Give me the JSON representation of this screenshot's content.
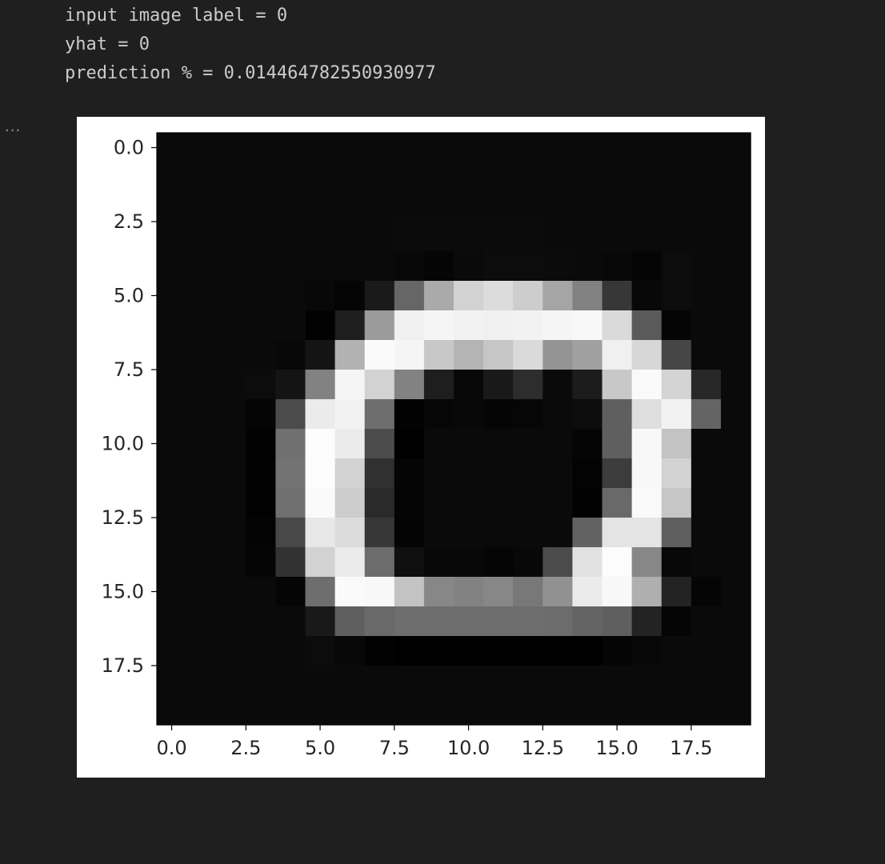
{
  "output": {
    "lines": [
      "input image label = 0",
      "yhat = 0",
      "prediction % = 0.014464782550930977"
    ],
    "overflow_menu": "..."
  },
  "chart_data": {
    "type": "heatmap",
    "colormap": "gray",
    "rows": 20,
    "cols": 20,
    "x_ticks": [
      "0.0",
      "2.5",
      "5.0",
      "7.5",
      "10.0",
      "12.5",
      "15.0",
      "17.5"
    ],
    "y_ticks": [
      "0.0",
      "2.5",
      "5.0",
      "7.5",
      "10.0",
      "12.5",
      "15.0",
      "17.5"
    ],
    "xlim": [
      -0.5,
      19.5
    ],
    "ylim": [
      19.5,
      -0.5
    ],
    "grid": false,
    "values": [
      [
        10,
        10,
        10,
        10,
        10,
        10,
        10,
        10,
        10,
        10,
        10,
        10,
        10,
        10,
        10,
        10,
        10,
        10,
        10,
        10
      ],
      [
        10,
        10,
        10,
        10,
        10,
        10,
        10,
        10,
        10,
        10,
        10,
        10,
        10,
        10,
        10,
        10,
        10,
        10,
        10,
        10
      ],
      [
        10,
        10,
        10,
        10,
        10,
        10,
        10,
        10,
        10,
        10,
        10,
        10,
        10,
        10,
        10,
        10,
        10,
        10,
        10,
        10
      ],
      [
        10,
        10,
        10,
        10,
        10,
        10,
        10,
        10,
        11,
        11,
        11,
        11,
        11,
        10,
        10,
        10,
        10,
        10,
        10,
        10
      ],
      [
        10,
        10,
        10,
        10,
        10,
        10,
        10,
        10,
        8,
        5,
        10,
        12,
        12,
        11,
        10,
        8,
        5,
        12,
        10,
        10
      ],
      [
        10,
        10,
        10,
        10,
        10,
        8,
        5,
        26,
        102,
        170,
        210,
        220,
        205,
        165,
        130,
        55,
        8,
        12,
        10,
        10
      ],
      [
        10,
        10,
        10,
        10,
        10,
        2,
        30,
        155,
        240,
        245,
        242,
        240,
        242,
        245,
        248,
        218,
        90,
        5,
        10,
        10
      ],
      [
        10,
        10,
        10,
        10,
        8,
        20,
        178,
        250,
        245,
        200,
        180,
        198,
        218,
        148,
        160,
        240,
        215,
        70,
        10,
        10
      ],
      [
        10,
        10,
        10,
        12,
        20,
        130,
        245,
        210,
        130,
        30,
        8,
        25,
        45,
        10,
        28,
        200,
        250,
        212,
        40,
        10
      ],
      [
        10,
        10,
        10,
        5,
        75,
        235,
        242,
        110,
        2,
        6,
        8,
        5,
        6,
        10,
        12,
        95,
        222,
        242,
        100,
        10
      ],
      [
        10,
        10,
        10,
        2,
        112,
        252,
        235,
        75,
        0,
        10,
        10,
        10,
        10,
        10,
        5,
        95,
        248,
        195,
        10,
        10
      ],
      [
        10,
        10,
        10,
        2,
        115,
        252,
        210,
        48,
        5,
        10,
        10,
        10,
        10,
        10,
        3,
        60,
        248,
        210,
        10,
        10
      ],
      [
        10,
        10,
        10,
        2,
        112,
        250,
        205,
        42,
        5,
        10,
        10,
        10,
        10,
        10,
        2,
        105,
        250,
        198,
        10,
        10
      ],
      [
        10,
        10,
        10,
        4,
        72,
        232,
        220,
        55,
        4,
        10,
        10,
        10,
        10,
        10,
        98,
        228,
        228,
        95,
        10,
        10
      ],
      [
        10,
        10,
        10,
        5,
        50,
        210,
        235,
        108,
        15,
        8,
        8,
        5,
        8,
        75,
        225,
        252,
        135,
        8,
        10,
        10
      ],
      [
        10,
        10,
        10,
        10,
        5,
        110,
        250,
        248,
        195,
        135,
        130,
        135,
        120,
        145,
        235,
        248,
        175,
        35,
        5,
        10
      ],
      [
        10,
        10,
        10,
        10,
        10,
        25,
        95,
        105,
        110,
        110,
        110,
        110,
        110,
        108,
        100,
        95,
        35,
        5,
        10,
        10
      ],
      [
        10,
        10,
        10,
        10,
        10,
        12,
        8,
        2,
        0,
        0,
        0,
        0,
        0,
        0,
        0,
        5,
        8,
        10,
        10,
        10
      ],
      [
        10,
        10,
        10,
        10,
        10,
        10,
        10,
        10,
        10,
        10,
        10,
        10,
        10,
        10,
        10,
        10,
        10,
        10,
        10,
        10
      ],
      [
        10,
        10,
        10,
        10,
        10,
        10,
        10,
        10,
        10,
        10,
        10,
        10,
        10,
        10,
        10,
        10,
        10,
        10,
        10,
        10
      ]
    ]
  }
}
